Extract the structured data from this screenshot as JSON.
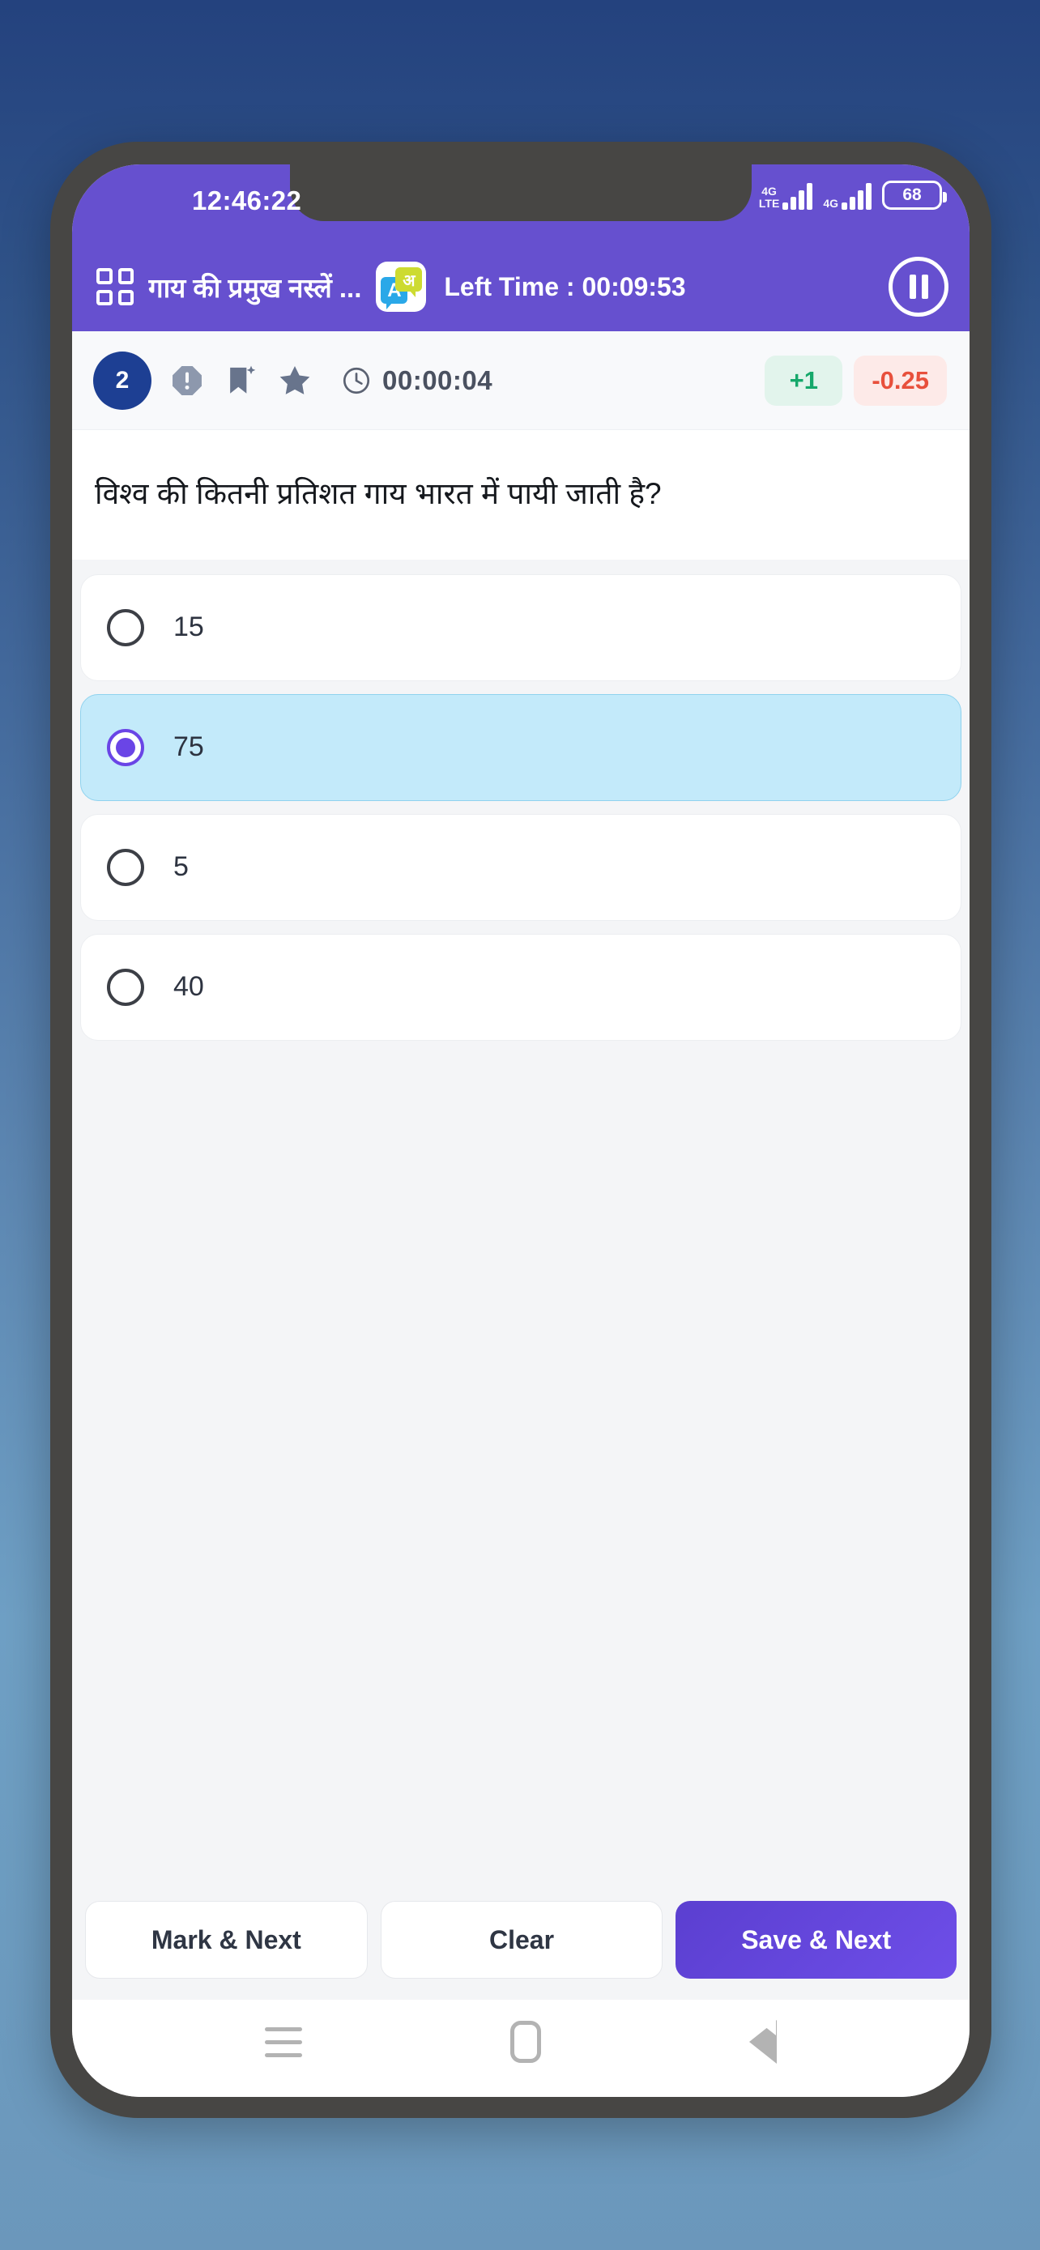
{
  "status_bar": {
    "time": "12:46:22",
    "network_label_1": "4G",
    "network_label_1b": "LTE",
    "network_label_2": "4G",
    "battery_level": "68"
  },
  "header": {
    "menu_icon": "grid-icon",
    "title": "गाय की प्रमुख नस्लें ...",
    "translate_icon_left": "A",
    "translate_icon_right": "अ",
    "left_time_label": "Left Time : 00:09:53",
    "pause_icon": "pause-icon"
  },
  "toolbar": {
    "question_number": "2",
    "report_icon": "report-warning-icon",
    "bookmark_icon": "bookmark-icon",
    "star_icon": "star-icon",
    "clock_icon": "clock-icon",
    "elapsed_time": "00:00:04",
    "positive_marks": "+1",
    "negative_marks": "-0.25",
    "positive_color": "#16a86b",
    "positive_bg": "#e2f4ec",
    "negative_color": "#e8503c",
    "negative_bg": "#fdeae8"
  },
  "question": {
    "text": "विश्व की कितनी प्रतिशत गाय भारत में पायी जाती है?",
    "options": [
      {
        "label": "15",
        "selected": false
      },
      {
        "label": "75",
        "selected": true
      },
      {
        "label": "5",
        "selected": false
      },
      {
        "label": "40",
        "selected": false
      }
    ]
  },
  "actions": {
    "mark_next": "Mark & Next",
    "clear": "Clear",
    "save_next": "Save & Next",
    "primary_color": "#6650cf"
  },
  "nav_bar": {
    "recents_icon": "recents-icon",
    "home_icon": "home-icon",
    "back_icon": "back-icon"
  },
  "theme": {
    "header_purple": "#6650cf",
    "badge_navy": "#1d3f93",
    "selected_option_bg": "#c3eafa",
    "radio_purple": "#6a45e6"
  }
}
